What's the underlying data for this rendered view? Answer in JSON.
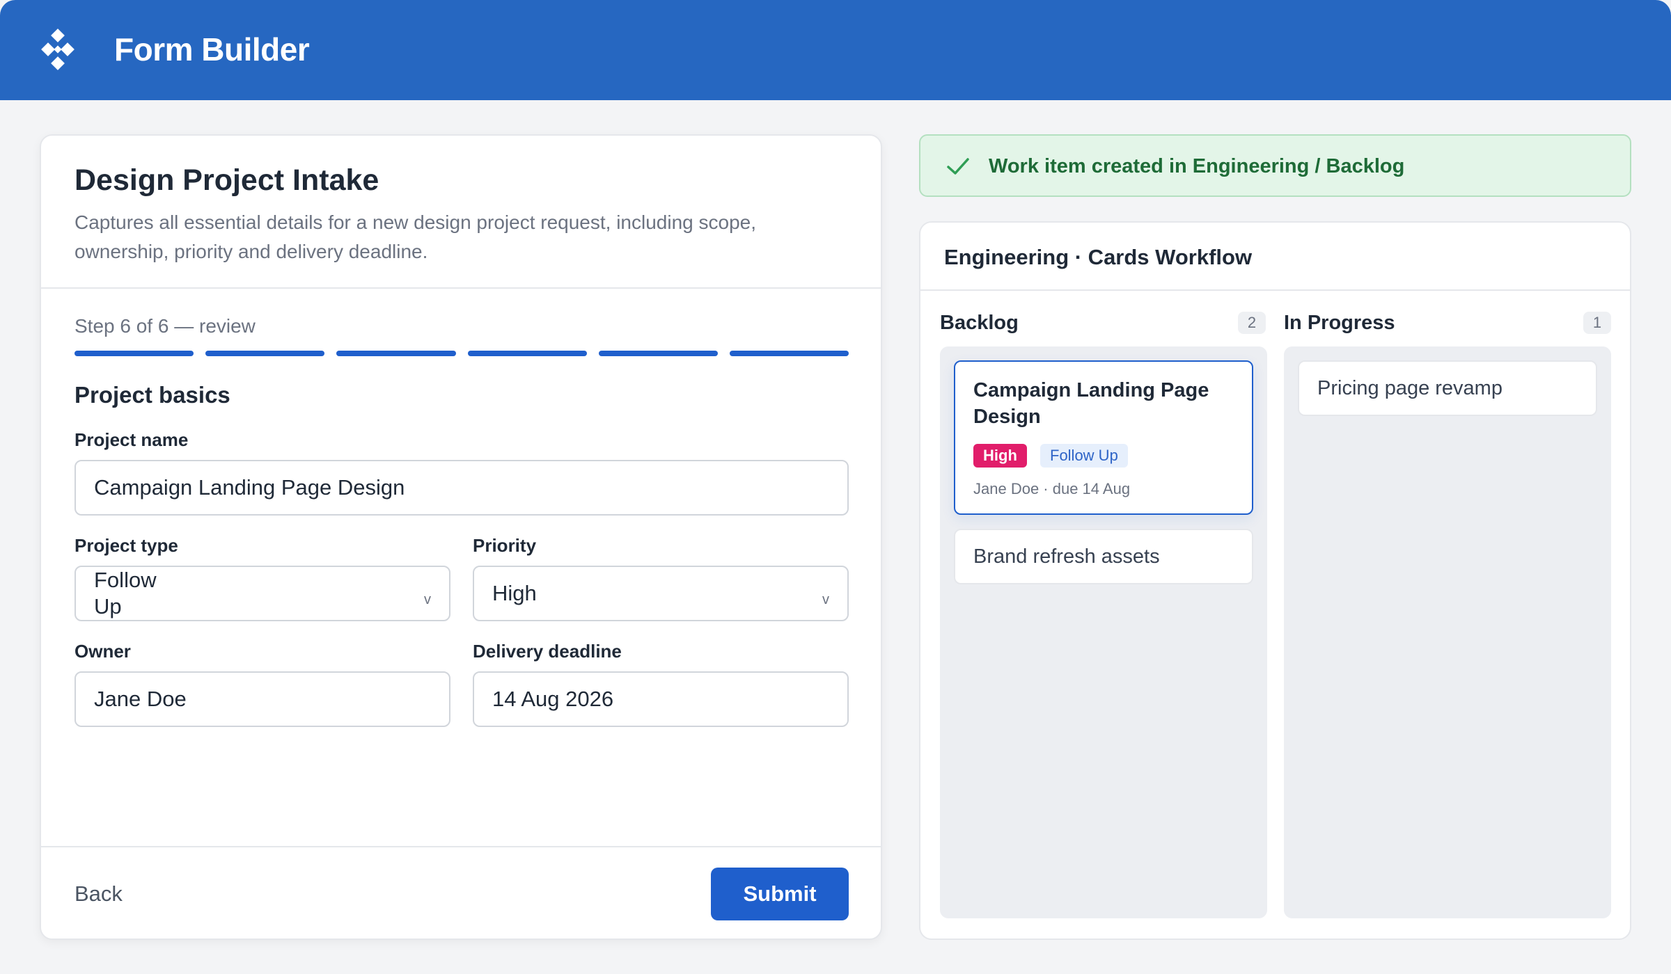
{
  "app": {
    "title": "Form Builder",
    "logo_icon": "diamond-grid-icon"
  },
  "form": {
    "title": "Design Project Intake",
    "description": "Captures all essential details for a new design project request, including scope, ownership, priority and delivery deadline.",
    "step_label": "Step 6 of 6 — review",
    "progress": {
      "current_step": 6,
      "total_steps": 6
    },
    "section_title": "Project basics",
    "fields": {
      "project_name": {
        "label": "Project name",
        "value": "Campaign Landing Page Design"
      },
      "project_type": {
        "label": "Project type",
        "value": "Follow Up"
      },
      "priority": {
        "label": "Priority",
        "value": "High"
      },
      "owner": {
        "label": "Owner",
        "value": "Jane Doe"
      },
      "deadline": {
        "label": "Delivery deadline",
        "value": "14 Aug 2026"
      }
    },
    "chevron_glyph": "v",
    "back_label": "Back",
    "submit_label": "Submit",
    "colors": {
      "accent": "#1f5fcc"
    }
  },
  "banner": {
    "message": "Work item created in Engineering / Backlog",
    "icon": "check-icon",
    "colors": {
      "background": "#e3f5e8",
      "text": "#1e6b37"
    }
  },
  "board": {
    "title": "Engineering · Cards Workflow",
    "columns": [
      {
        "name": "Backlog",
        "count": "2",
        "cards": [
          {
            "title": "Campaign Landing Page Design",
            "tags": [
              "High",
              "Follow Up"
            ],
            "meta": "Jane Doe · due 14 Aug",
            "selected": true
          },
          {
            "title": "Brand refresh assets"
          }
        ]
      },
      {
        "name": "In Progress",
        "count": "1",
        "cards": [
          {
            "title": "Pricing page revamp"
          }
        ]
      }
    ],
    "colors": {
      "high_tag": "#e11d6a",
      "follow_up_tag": "#2e64c7"
    }
  }
}
